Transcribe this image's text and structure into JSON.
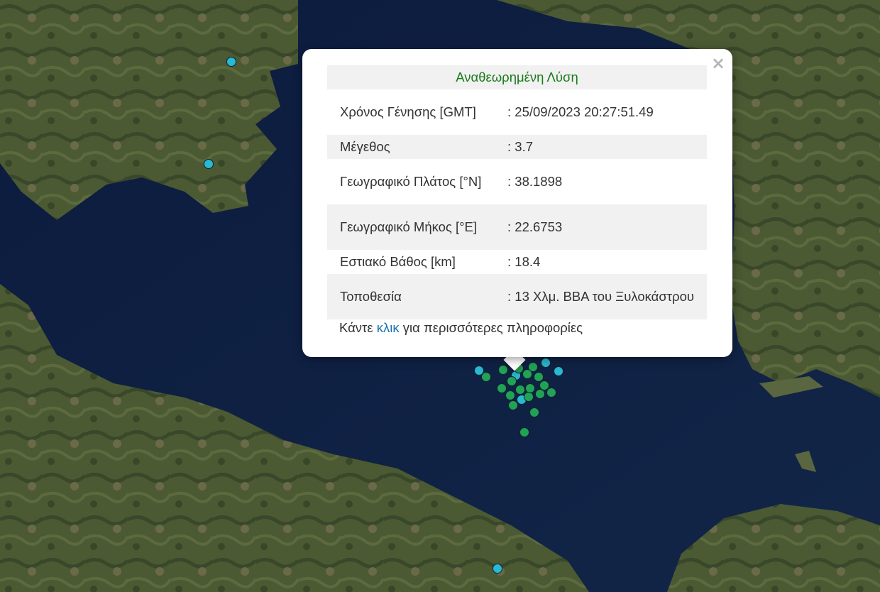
{
  "popup": {
    "title": "Αναθεωρημένη Λύση",
    "close_glyph": "×",
    "rows": [
      {
        "label": "Χρόνος Γένησης [GMT]",
        "value": ": 25/09/2023 20:27:51.49"
      },
      {
        "label": "Μέγεθος",
        "value": ": 3.7"
      },
      {
        "label": "Γεωγραφικό Πλάτος [°N]",
        "value": ": 38.1898"
      },
      {
        "label": "Γεωγραφικό Μήκος [°E]",
        "value": ": 22.6753"
      },
      {
        "label": "Εστιακό Βάθος [km]",
        "value": ": 18.4"
      },
      {
        "label": "Τοποθεσία",
        "value": ": 13 Χλμ. ΒΒΑ του Ξυλοκάστρου"
      }
    ],
    "more_before": "Κάντε ",
    "more_link": "κλικ",
    "more_after": " για περισσότερες πληροφορίες"
  },
  "colors": {
    "sea": "#0f1e40",
    "land": "#4a5a32",
    "marker_recent": "#29b9d2",
    "marker_older": "#21a355",
    "title_green": "#1a7a1a",
    "link_blue": "#1a6fb0"
  }
}
